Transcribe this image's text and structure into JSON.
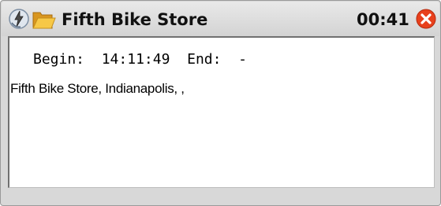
{
  "window": {
    "title": "Fifth Bike Store",
    "timer": "00:41",
    "icons": [
      "lightning-plug-icon",
      "folder-icon",
      "close-icon"
    ],
    "colors": {
      "close": "#e8401c",
      "folder": "#f1b62f",
      "titlebar": "#dcdcdc"
    }
  },
  "content": {
    "begin_label": "Begin:",
    "begin_time": "14:11:49",
    "end_label": "End:",
    "end_time": "-",
    "details": "Fifth Bike Store, Indianapolis, ,"
  }
}
